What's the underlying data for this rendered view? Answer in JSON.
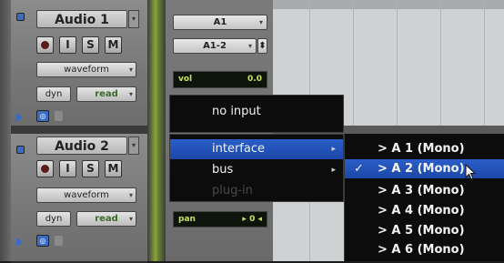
{
  "tracks": [
    {
      "name": "Audio 1",
      "buttons": {
        "rec": "",
        "input": "I",
        "solo": "S",
        "mute": "M"
      },
      "view": "waveform",
      "dyn": "dyn",
      "automation": "read",
      "input": "A1",
      "output": "A1-2",
      "vol_label": "vol",
      "vol_value": "0.0"
    },
    {
      "name": "Audio 2",
      "buttons": {
        "rec": "",
        "input": "I",
        "solo": "S",
        "mute": "M"
      },
      "view": "waveform",
      "dyn": "dyn",
      "automation": "read",
      "pan_label": "pan",
      "pan_value": "▸ 0 ◂"
    }
  ],
  "menu": {
    "items": [
      {
        "label": "no input",
        "enabled": true,
        "highlighted": false
      },
      {
        "label": "interface",
        "enabled": true,
        "highlighted": true,
        "submenu": true
      },
      {
        "label": "bus",
        "enabled": true,
        "highlighted": false,
        "submenu": true
      },
      {
        "label": "plug-in",
        "enabled": false,
        "highlighted": false
      }
    ],
    "submenu_arrow": "▸",
    "submenu_items": [
      {
        "label": "> A 1 (Mono)",
        "checked": false,
        "highlighted": false
      },
      {
        "label": "> A 2 (Mono)",
        "checked": true,
        "highlighted": true
      },
      {
        "label": "> A 3 (Mono)",
        "checked": false,
        "highlighted": false
      },
      {
        "label": "> A 4 (Mono)",
        "checked": false,
        "highlighted": false
      },
      {
        "label": "> A 5 (Mono)",
        "checked": false,
        "highlighted": false
      },
      {
        "label": "> A 6 (Mono)",
        "checked": false,
        "highlighted": false
      }
    ],
    "checkmark": "✓"
  },
  "colors": {
    "highlight": "#2352b8",
    "meter_green": "#8aa53c",
    "read_green": "#3a6b2a",
    "vol_text": "#c8e060"
  }
}
